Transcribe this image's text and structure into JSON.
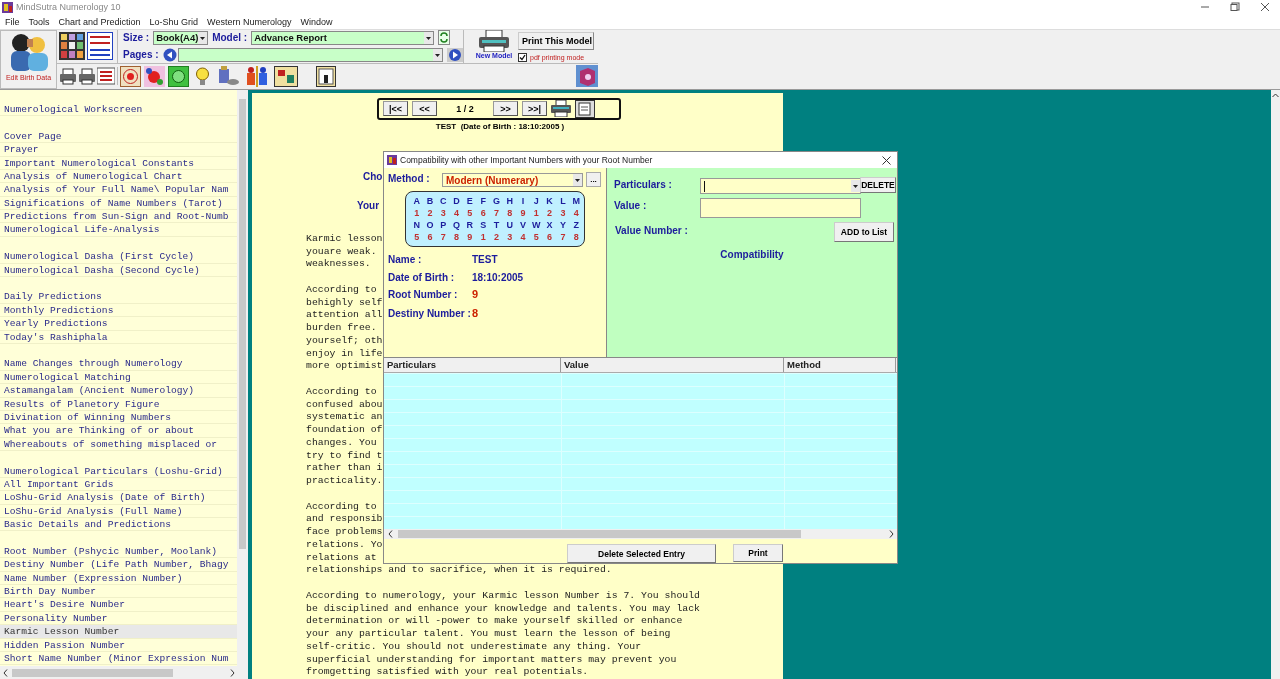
{
  "window": {
    "title": "MindSutra Numerology 10"
  },
  "menu": [
    "File",
    "Tools",
    "Chart and Prediction",
    "Lo-Shu Grid",
    "Western Numerology",
    "Window"
  ],
  "toolbar": {
    "edit_birth_data": "Edit Birth Data",
    "size_label": "Size :",
    "size_value": "Book(A4)",
    "model_label": "Model :",
    "model_value": "Advance Report",
    "pages_label": "Pages :",
    "new_model": "New Model",
    "print_button": "Print This Model",
    "pdf_mode": {
      "label": "pdf printing mode",
      "checked": true
    }
  },
  "sidebar": {
    "groups": [
      {
        "items": [
          {
            "label": "Numerological Workscreen",
            "selected": false
          }
        ]
      },
      {
        "items": [
          {
            "label": "Cover Page",
            "selected": false
          },
          {
            "label": "Prayer",
            "selected": false
          },
          {
            "label": "Important Numerological Constants",
            "selected": false
          },
          {
            "label": "Analysis of Numerological Chart",
            "selected": false
          },
          {
            "label": "Analysis of Your Full Name\\ Popular Nam",
            "selected": false
          },
          {
            "label": "Significations of Name Numbers (Tarot)",
            "selected": false
          },
          {
            "label": "Predictions from Sun-Sign and Root-Numb",
            "selected": false
          },
          {
            "label": "Numerological Life-Analysis",
            "selected": false
          }
        ]
      },
      {
        "items": [
          {
            "label": "Numerological Dasha (First Cycle)",
            "selected": false
          },
          {
            "label": "Numerological Dasha (Second Cycle)",
            "selected": false
          }
        ]
      },
      {
        "items": [
          {
            "label": "Daily Predictions",
            "selected": false
          },
          {
            "label": "Monthly Predictions",
            "selected": false
          },
          {
            "label": "Yearly Predictions",
            "selected": false
          },
          {
            "label": "Today's Rashiphala",
            "selected": false
          }
        ]
      },
      {
        "items": [
          {
            "label": "Name Changes through Numerology",
            "selected": false
          },
          {
            "label": "Numerological Matching",
            "selected": false
          },
          {
            "label": "Astamangalam (Ancient Numerology)",
            "selected": false
          },
          {
            "label": "Results of Planetory Figure",
            "selected": false
          },
          {
            "label": "Divination of Winning Numbers",
            "selected": false
          },
          {
            "label": "What you are Thinking of or about",
            "selected": false
          },
          {
            "label": "Whereabouts of something misplaced or",
            "selected": false
          }
        ]
      },
      {
        "items": [
          {
            "label": "Numerological Particulars (Loshu-Grid)",
            "selected": false
          },
          {
            "label": "All Important Grids",
            "selected": false
          },
          {
            "label": "LoShu-Grid Analysis (Date of Birth)",
            "selected": false
          },
          {
            "label": "LoShu-Grid Analysis (Full Name)",
            "selected": false
          },
          {
            "label": "Basic Details and Predictions",
            "selected": false
          }
        ]
      },
      {
        "items": [
          {
            "label": "Root Number (Pshycic Number, Moolank)",
            "selected": false
          },
          {
            "label": "Destiny Number (Life Path Number, Bhagy",
            "selected": false
          },
          {
            "label": "Name Number (Expression Number)",
            "selected": false
          },
          {
            "label": "Birth Day Number",
            "selected": false
          },
          {
            "label": "Heart's Desire Number",
            "selected": false
          },
          {
            "label": "Personality Number",
            "selected": false
          },
          {
            "label": "Karmic Lesson Number",
            "selected": true
          },
          {
            "label": "Hidden Passion Number",
            "selected": false
          },
          {
            "label": "Short Name Number (Minor Expression Num",
            "selected": false
          }
        ]
      }
    ]
  },
  "document": {
    "nav": {
      "buttons_before": [
        "|<<",
        "<<"
      ],
      "page": "1 / 2",
      "buttons_after": [
        ">>",
        ">>|"
      ]
    },
    "subtitle": "TEST  (Date of Birth : 18:10:2005 )",
    "fragments": [
      "Cho",
      "Your"
    ],
    "paragraphs": [
      {
        "lines": [
          "Karmic lesson",
          "youare weak.",
          "weaknesses."
        ]
      },
      {
        "lines": [
          "According to",
          "behighly self",
          "attention all",
          "burden free.",
          "yourself; oth",
          "enjoy in life",
          "more optimist"
        ]
      },
      {
        "lines": [
          "According to",
          "confused abou",
          "systematic an",
          "foundation of",
          "changes. You",
          "try to find t",
          "rather than i",
          "practicality."
        ]
      },
      {
        "lines": [
          "According to",
          "and responsib",
          "face problems",
          "relations. Yo",
          "relations at",
          "relationships and to sacrifice, when it is required."
        ]
      },
      {
        "lines": [
          "According to numerology, your Karmic lesson Number is 7. You should",
          "be disciplined and enhance your knowledge and talents. You may lack",
          "determination or will -power to make yourself skilled or enhance",
          "your any particular talent. You must learn the lesson of being",
          "self-critic. You should not underestimate any thing. Your",
          "superficial understanding for important matters may prevent you",
          "fromgetting satisfied with your real potentials."
        ]
      }
    ]
  },
  "dialog": {
    "title": "Compatibility with other Important Numbers with your Root Number",
    "method_label": "Method :",
    "method_value": "Modern (Numerary)",
    "more_button": "...",
    "letter_rows": [
      {
        "letters": [
          "A",
          "B",
          "C",
          "D",
          "E",
          "F",
          "G",
          "H",
          "I",
          "J",
          "K",
          "L",
          "M"
        ],
        "numbers": [
          "1",
          "2",
          "3",
          "4",
          "5",
          "6",
          "7",
          "8",
          "9",
          "1",
          "2",
          "3",
          "4"
        ]
      },
      {
        "letters": [
          "N",
          "O",
          "P",
          "Q",
          "R",
          "S",
          "T",
          "U",
          "V",
          "W",
          "X",
          "Y",
          "Z"
        ],
        "numbers": [
          "5",
          "6",
          "7",
          "8",
          "9",
          "1",
          "2",
          "3",
          "4",
          "5",
          "6",
          "7",
          "8"
        ]
      }
    ],
    "details": [
      {
        "label": "Name :",
        "value": "TEST",
        "kind": "text"
      },
      {
        "label": "Date of Birth :",
        "value": "18:10:2005",
        "kind": "text"
      },
      {
        "label": "Root Number :",
        "value": "9",
        "kind": "number"
      },
      {
        "label": "Destiny Number :",
        "value": "8",
        "kind": "number"
      }
    ],
    "particulars_label": "Particulars :",
    "delete_button": "DELETE",
    "value_label": "Value :",
    "value_number_label": "Value Number :",
    "add_button": "ADD to List",
    "compatibility": "Compatibility",
    "table": {
      "columns": [
        "Particulars",
        "Value",
        "Method"
      ]
    },
    "buttons": [
      "Delete Selected Entry",
      "Print"
    ]
  }
}
